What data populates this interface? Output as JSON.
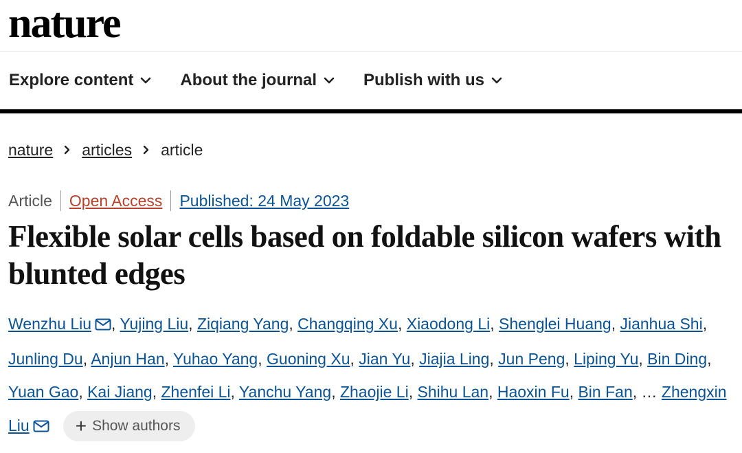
{
  "header": {
    "logo": "nature",
    "nav": [
      {
        "label": "Explore content"
      },
      {
        "label": "About the journal"
      },
      {
        "label": "Publish with us"
      }
    ]
  },
  "breadcrumb": {
    "items": [
      "nature",
      "articles"
    ],
    "current": "article"
  },
  "article": {
    "type": "Article",
    "open_access": "Open Access",
    "published": "Published: 24 May 2023",
    "title": "Flexible solar cells based on foldable silicon wafers with blunted edges",
    "authors": [
      "Wenzhu Liu",
      "Yujing Liu",
      "Ziqiang Yang",
      "Changqing Xu",
      "Xiaodong Li",
      "Shenglei Huang",
      "Jianhua Shi",
      "Junling Du",
      "Anjun Han",
      "Yuhao Yang",
      "Guoning Xu",
      "Jian Yu",
      "Jiajia Ling",
      "Jun Peng",
      "Liping Yu",
      "Bin Ding",
      "Yuan Gao",
      "Kai Jiang",
      "Zhenfei Li",
      "Yanchu Yang",
      "Zhaojie Li",
      "Shihu Lan",
      "Haoxin Fu",
      "Bin Fan"
    ],
    "ellipsis": "…",
    "last_author": "Zhengxin Liu",
    "show_authors_label": "Show authors"
  },
  "colors": {
    "link": "#0b5394",
    "open_access": "#b7412b",
    "divider": "#000000"
  },
  "icons": {
    "nav_chevron": "chevron-down-icon",
    "breadcrumb_sep": "chevron-right-icon",
    "corresponding": "mail-icon",
    "expand": "plus-icon"
  }
}
